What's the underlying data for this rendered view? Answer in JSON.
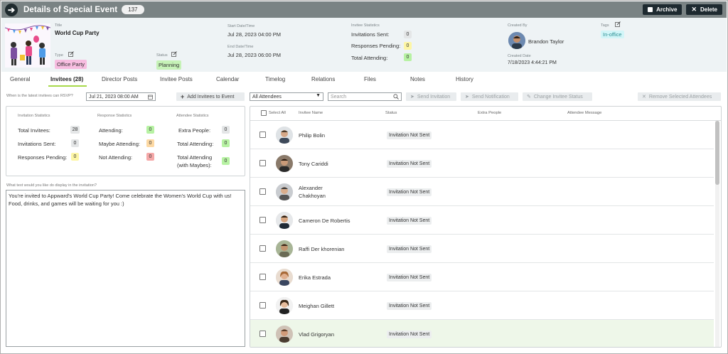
{
  "header": {
    "title": "Details of Special Event",
    "count": "137",
    "archive_label": "Archive",
    "delete_label": "Delete"
  },
  "event": {
    "title_label": "Title",
    "title": "World Cup Party",
    "type_label": "Type",
    "type": "Office Party",
    "status_label": "Status",
    "status": "Planning",
    "start_label": "Start Date/Time",
    "start": "Jul 28, 2023 04:00 PM",
    "end_label": "End Date/Time",
    "end": "Jul 28, 2023 06:00 PM",
    "stats_label": "Invitee Statistics",
    "invitations_sent_label": "Invitations Sent:",
    "invitations_sent": "0",
    "responses_pending_label": "Responses Pending:",
    "responses_pending": "0",
    "total_attending_label": "Total Attending:",
    "total_attending": "0",
    "created_by_label": "Created By",
    "created_by": "Brandon Taylor",
    "created_date_label": "Created Date",
    "created_date": "7/18/2023 4:44:21 PM",
    "tags_label": "Tags",
    "tag": "In-office"
  },
  "tabs": [
    "General",
    "Invitees (28)",
    "Director Posts",
    "Invitee Posts",
    "Calendar",
    "Timelog",
    "Relations",
    "Files",
    "Notes",
    "History"
  ],
  "toolbar": {
    "rsvp_label": "When is the latest invitees can RSVP?",
    "rsvp_value": "Jul 21, 2023 08:00 AM",
    "add_label": "Add Invitees to Event",
    "filter_value": "All Attendees",
    "search_placeholder": "Search",
    "send_invitation": "Send Invitation",
    "send_notification": "Send Notification",
    "change_status": "Change Invitee Status",
    "remove_selected": "Remove Selected Attendees"
  },
  "stats": {
    "invitation_header": "Invitation Statistics",
    "response_header": "Response Statistics",
    "attendee_header": "Attendee Statistics",
    "total_invitees_label": "Total Invitees:",
    "total_invitees": "28",
    "invitations_sent_label": "Invitations Sent:",
    "invitations_sent": "0",
    "responses_pending_label": "Responses Pending:",
    "responses_pending": "0",
    "attending_label": "Attending:",
    "attending": "0",
    "maybe_label": "Maybe Attending:",
    "maybe": "0",
    "not_attending_label": "Not Attending:",
    "not_attending": "0",
    "extra_people_label": "Extra People:",
    "extra_people": "0",
    "total_attending_label": "Total Attending:",
    "total_attending": "0",
    "total_with_maybes_label_1": "Total Attending",
    "total_with_maybes_label_2": "(with Maybes):",
    "total_with_maybes": "0"
  },
  "invitation_text": {
    "label": "What text would you like do display in the invitation?",
    "value": "You're invited to Appward's World Cup Party! Come celebrate the Women's World Cup with us! Food, drinks, and games will be waiting for you :)"
  },
  "table": {
    "headers": {
      "select_all": "Select All",
      "name": "Invitee Name",
      "status": "Status",
      "extra": "Extra People",
      "message": "Attendee Message"
    },
    "rows": [
      {
        "name": "Philip Bolin",
        "status": "Invitation Not Sent"
      },
      {
        "name": "Tony Cariddi",
        "status": "Invitation Not Sent"
      },
      {
        "name": "Alexander Chakhoyan",
        "name_line1": "Alexander",
        "name_line2": "Chakhoyan",
        "status": "Invitation Not Sent"
      },
      {
        "name": "Cameron De Robertis",
        "status": "Invitation Not Sent"
      },
      {
        "name": "Raffi Der khorenian",
        "status": "Invitation Not Sent"
      },
      {
        "name": "Erika Estrada",
        "status": "Invitation Not Sent"
      },
      {
        "name": "Meighan Gillett",
        "status": "Invitation Not Sent"
      },
      {
        "name": "Vlad Grigoryan",
        "status": "Invitation Not Sent"
      }
    ]
  },
  "colors": {
    "header_bg": "#7a8384",
    "info_bg": "#eef3f5",
    "active_tab_accent": "#a7d94a"
  }
}
